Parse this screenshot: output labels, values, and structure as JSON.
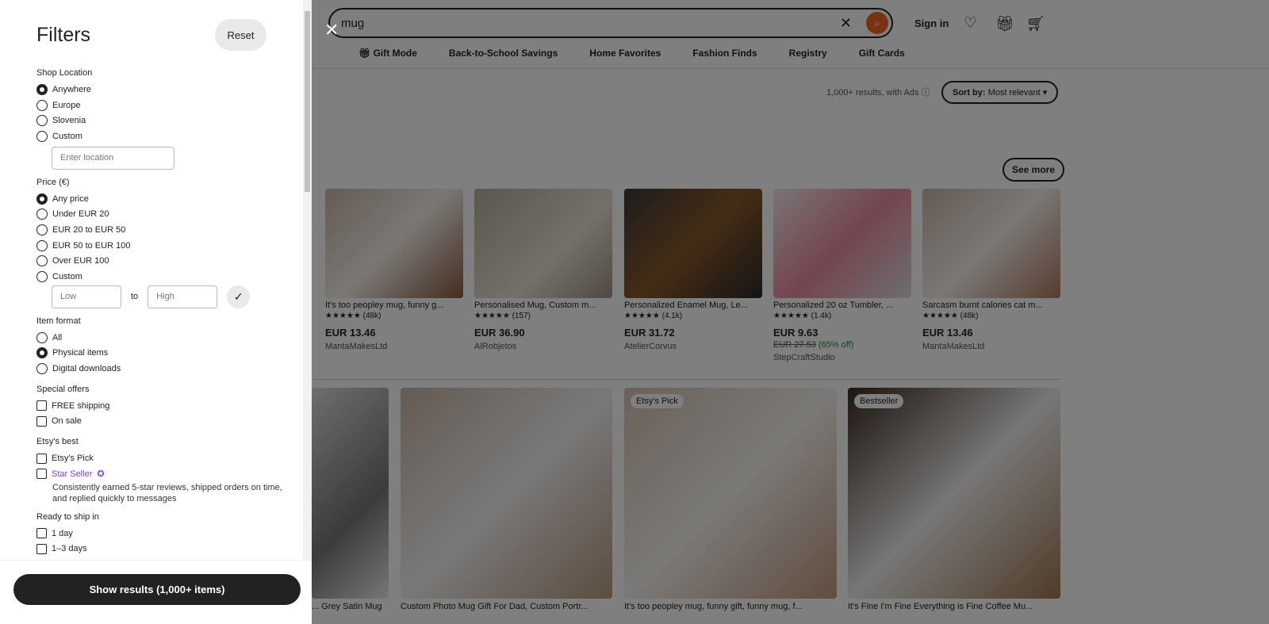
{
  "header": {
    "search_value": "mug",
    "sign_in": "Sign in",
    "nav": [
      "Gift Mode",
      "Back-to-School Savings",
      "Home Favorites",
      "Fashion Finds",
      "Registry",
      "Gift Cards"
    ]
  },
  "results": {
    "count_text": "1,000+ results, with Ads",
    "sort_prefix": "Sort by:",
    "sort_value": "Most relevant",
    "see_more": "See more"
  },
  "row1": [
    {
      "title": "It's too peopley mug, funny g...",
      "reviews": "(48k)",
      "price": "EUR 13.46",
      "shop": "MantaMakesLtd"
    },
    {
      "title": "Personalised Mug, Custom m...",
      "reviews": "(157)",
      "price": "EUR 36.90",
      "shop": "AlRobjetos"
    },
    {
      "title": "Personalized Enamel Mug, Le...",
      "reviews": "(4.1k)",
      "price": "EUR 31.72",
      "shop": "AtelierCorvus"
    },
    {
      "title": "Personalized 20 oz Tumbler, ...",
      "reviews": "(1.4k)",
      "price": "EUR 9.63",
      "orig": "EUR 27.53",
      "off": "(65% off)",
      "shop": "StepCraftStudio"
    },
    {
      "title": "Sarcasm burnt calories cat m...",
      "reviews": "(48k)",
      "price": "EUR 13.46",
      "shop": "MantaMakesLtd"
    }
  ],
  "row2": [
    {
      "title": "Grey Satin Mug ..."
    },
    {
      "title": "Custom Photo Mug Gift For Dad, Custom Portr..."
    },
    {
      "title": "It's too peopley mug, funny gift, funny mug, f...",
      "badge": "Etsy's Pick"
    },
    {
      "title": "It's Fine I'm Fine Everything is Fine Coffee Mu...",
      "badge": "Bestseller"
    }
  ],
  "filters": {
    "title": "Filters",
    "reset": "Reset",
    "location": {
      "label": "Shop Location",
      "options": [
        "Anywhere",
        "Europe",
        "Slovenia",
        "Custom"
      ],
      "selected": 0,
      "placeholder": "Enter location"
    },
    "price": {
      "label": "Price (€)",
      "options": [
        "Any price",
        "Under EUR 20",
        "EUR 20 to EUR 50",
        "EUR 50 to EUR 100",
        "Over EUR 100",
        "Custom"
      ],
      "selected": 0,
      "low": "Low",
      "to": "to",
      "high": "High"
    },
    "format": {
      "label": "Item format",
      "options": [
        "All",
        "Physical items",
        "Digital downloads"
      ],
      "selected": 1
    },
    "offers": {
      "label": "Special offers",
      "options": [
        "FREE shipping",
        "On sale"
      ]
    },
    "best": {
      "label": "Etsy's best",
      "options": [
        "Etsy's Pick",
        "Star Seller"
      ],
      "star_desc": "Consistently earned 5-star reviews, shipped orders on time, and replied quickly to messages"
    },
    "ship": {
      "label": "Ready to ship in",
      "options": [
        "1 day",
        "1–3 days"
      ]
    },
    "show_results": "Show results (1,000+ items)"
  }
}
